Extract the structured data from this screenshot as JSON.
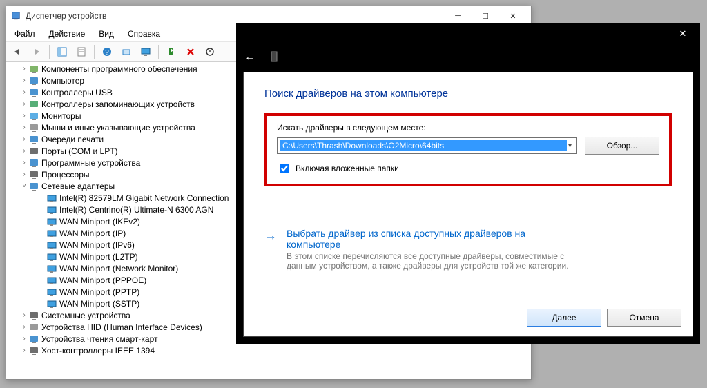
{
  "devmgr": {
    "title": "Диспетчер устройств",
    "menu": {
      "file": "Файл",
      "action": "Действие",
      "view": "Вид",
      "help": "Справка"
    },
    "tree": [
      {
        "label": "Компоненты программного обеспечения",
        "icon": "component"
      },
      {
        "label": "Компьютер",
        "icon": "computer"
      },
      {
        "label": "Контроллеры USB",
        "icon": "usb"
      },
      {
        "label": "Контроллеры запоминающих устройств",
        "icon": "storage"
      },
      {
        "label": "Мониторы",
        "icon": "monitor"
      },
      {
        "label": "Мыши и иные указывающие устройства",
        "icon": "mouse"
      },
      {
        "label": "Очереди печати",
        "icon": "printer"
      },
      {
        "label": "Порты (COM и LPT)",
        "icon": "port"
      },
      {
        "label": "Программные устройства",
        "icon": "soft"
      },
      {
        "label": "Процессоры",
        "icon": "cpu"
      },
      {
        "label": "Сетевые адаптеры",
        "icon": "net",
        "expanded": true,
        "children": [
          "Intel(R) 82579LM Gigabit Network Connection",
          "Intel(R) Centrino(R) Ultimate-N 6300 AGN",
          "WAN Miniport (IKEv2)",
          "WAN Miniport (IP)",
          "WAN Miniport (IPv6)",
          "WAN Miniport (L2TP)",
          "WAN Miniport (Network Monitor)",
          "WAN Miniport (PPPOE)",
          "WAN Miniport (PPTP)",
          "WAN Miniport (SSTP)"
        ]
      },
      {
        "label": "Системные устройства",
        "icon": "system"
      },
      {
        "label": "Устройства HID (Human Interface Devices)",
        "icon": "hid"
      },
      {
        "label": "Устройства чтения смарт-карт",
        "icon": "smartcard"
      },
      {
        "label": "Хост-контроллеры IEEE 1394",
        "icon": "1394"
      }
    ]
  },
  "wizard": {
    "panel_title": "Поиск драйверов на этом компьютере",
    "search_label": "Искать драйверы в следующем месте:",
    "path_value": "C:\\Users\\Thrash\\Downloads\\O2Micro\\64bits",
    "browse_label": "Обзор...",
    "include_sub_label": "Включая вложенные папки",
    "include_sub_checked": true,
    "option_title": "Выбрать драйвер из списка доступных драйверов на компьютере",
    "option_desc": "В этом списке перечисляются все доступные драйверы, совместимые с данным устройством, а также драйверы для устройств той же категории.",
    "next_label": "Далее",
    "cancel_label": "Отмена"
  }
}
